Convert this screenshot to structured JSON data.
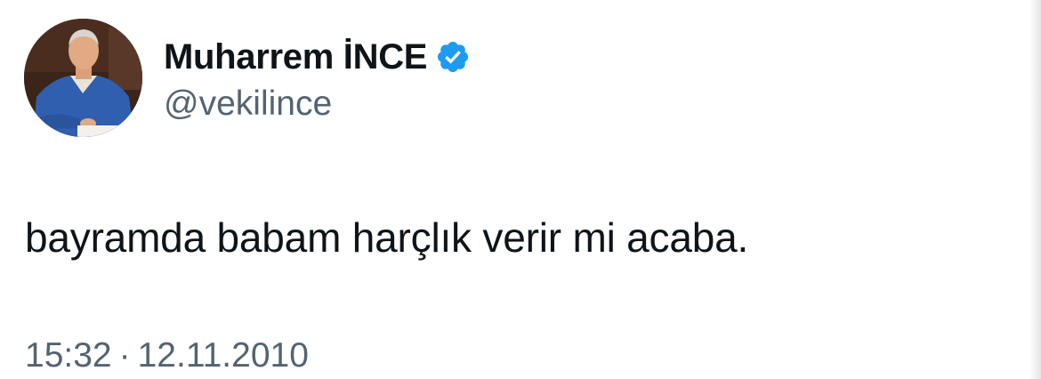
{
  "tweet": {
    "author": {
      "display_name": "Muharrem İNCE",
      "handle": "@vekilince",
      "verified": true,
      "verified_badge_icon": "verified-badge-icon",
      "avatar_icon": "avatar-photo"
    },
    "text": "bayramda babam harçlık verir mi acaba.",
    "time": "15:32",
    "separator": "·",
    "date": "12.11.2010"
  },
  "colors": {
    "text_primary": "#0f1419",
    "text_secondary": "#536471",
    "verified_blue": "#1d9bf0",
    "background": "#ffffff"
  }
}
